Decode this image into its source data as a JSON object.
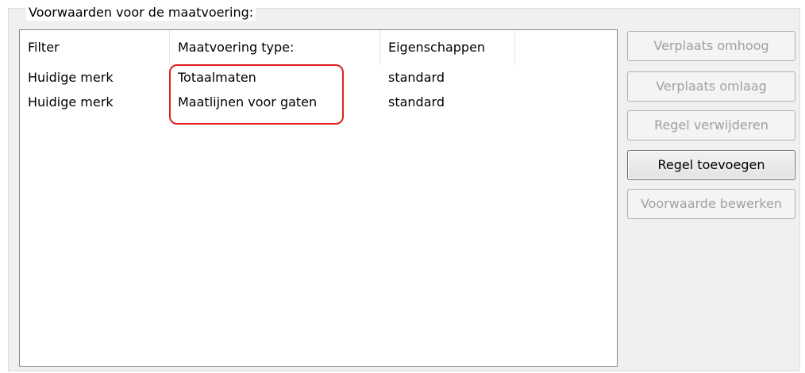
{
  "group": {
    "title": "Voorwaarden voor de maatvoering:"
  },
  "table": {
    "columns": [
      "Filter",
      "Maatvoering type:",
      "Eigenschappen",
      ""
    ],
    "rows": [
      {
        "filter": "Huidige merk",
        "type": "Totaalmaten",
        "properties": "standard"
      },
      {
        "filter": "Huidige merk",
        "type": "Maatlijnen voor gaten",
        "properties": "standard"
      }
    ]
  },
  "buttons": {
    "move_up": {
      "label": "Verplaats omhoog",
      "enabled": false
    },
    "move_down": {
      "label": "Verplaats omlaag",
      "enabled": false
    },
    "delete_rule": {
      "label": "Regel verwijderen",
      "enabled": false
    },
    "add_rule": {
      "label": "Regel toevoegen",
      "enabled": true
    },
    "edit_condition": {
      "label": "Voorwaarde bewerken",
      "enabled": false
    }
  },
  "colors": {
    "highlight": "#e0201e",
    "panel_bg": "#f0f0f0",
    "disabled_text": "#a0a0a0"
  }
}
